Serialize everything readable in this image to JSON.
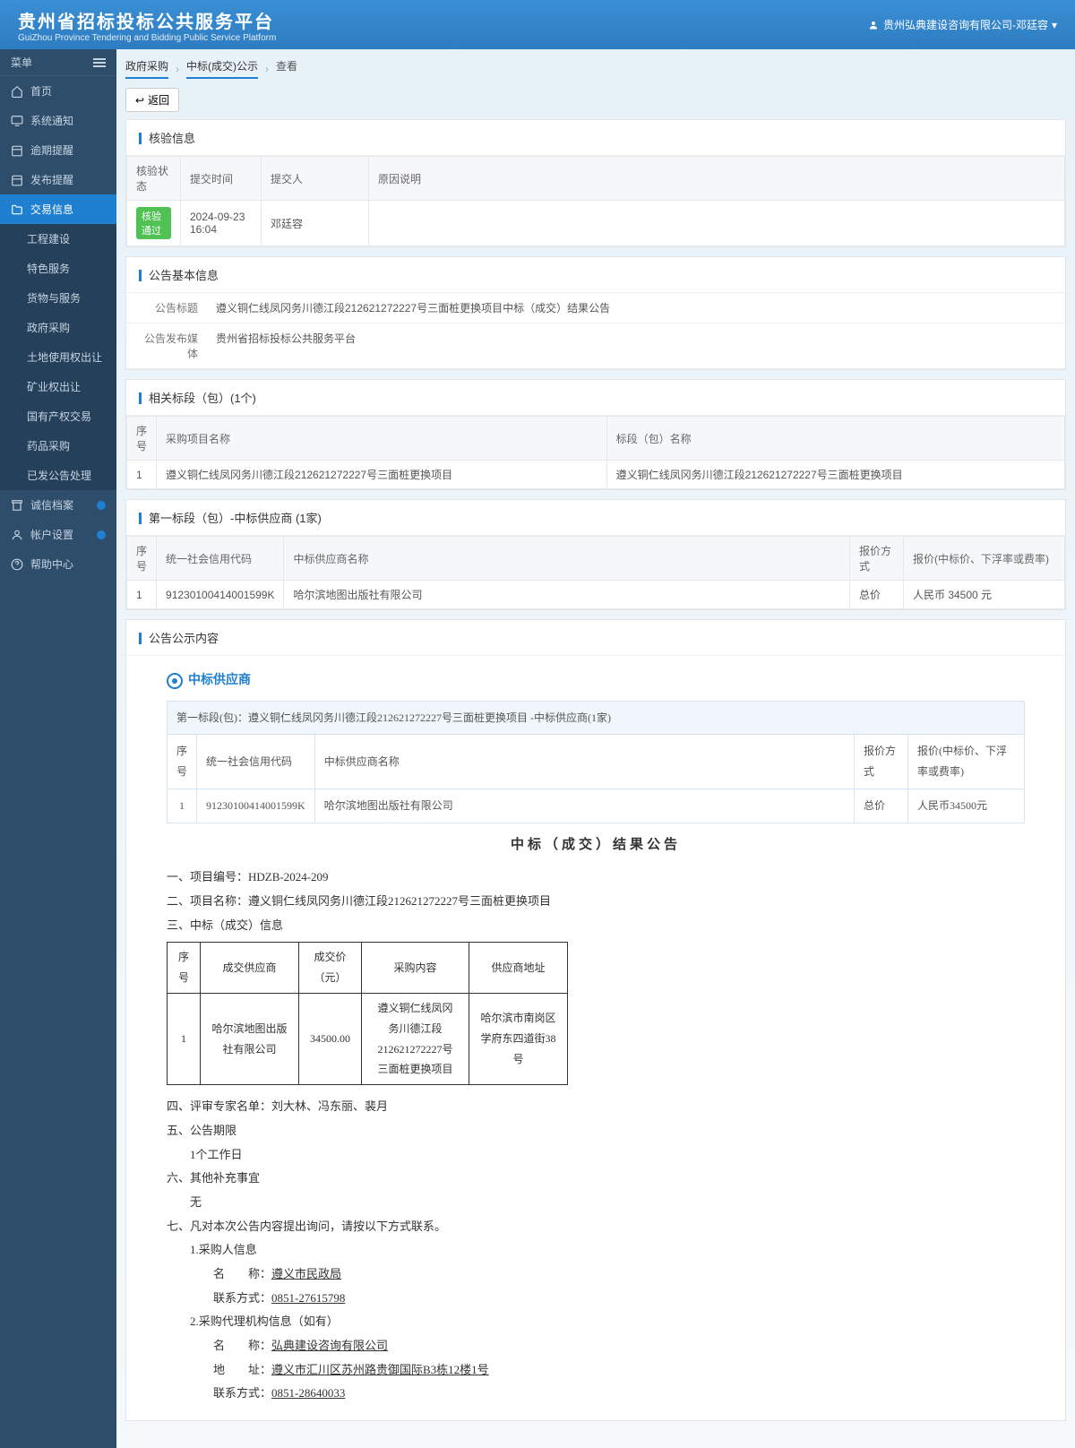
{
  "header": {
    "title": "贵州省招标投标公共服务平台",
    "subtitle": "GuiZhou Province Tendering and Bidding Public Service Platform",
    "user": "贵州弘典建设咨询有限公司-邓廷容"
  },
  "sidebar": {
    "menuLabel": "菜单",
    "items": [
      {
        "label": "首页",
        "icon": "home"
      },
      {
        "label": "系统通知",
        "icon": "monitor"
      },
      {
        "label": "逾期提醒",
        "icon": "calendar"
      },
      {
        "label": "发布提醒",
        "icon": "calendar"
      },
      {
        "label": "交易信息",
        "icon": "folder",
        "active": true,
        "badge": true,
        "sub": [
          {
            "label": "工程建设"
          },
          {
            "label": "特色服务"
          },
          {
            "label": "货物与服务"
          },
          {
            "label": "政府采购"
          },
          {
            "label": "土地使用权出让"
          },
          {
            "label": "矿业权出让"
          },
          {
            "label": "国有产权交易"
          },
          {
            "label": "药品采购"
          },
          {
            "label": "已发公告处理"
          }
        ]
      },
      {
        "label": "诚信档案",
        "icon": "archive",
        "badge": true
      },
      {
        "label": "帐户设置",
        "icon": "user",
        "badge": true
      },
      {
        "label": "帮助中心",
        "icon": "help"
      }
    ]
  },
  "breadcrumb": [
    "政府采购",
    "中标(成交)公示",
    "查看"
  ],
  "backBtn": "返回",
  "checkInfo": {
    "title": "核验信息",
    "headers": [
      "核验状态",
      "提交时间",
      "提交人",
      "原因说明"
    ],
    "row": {
      "status": "核验通过",
      "time": "2024-09-23 16:04",
      "person": "邓廷容",
      "reason": ""
    }
  },
  "basicInfo": {
    "title": "公告基本信息",
    "rows": [
      {
        "label": "公告标题",
        "value": "遵义铜仁线凤冈务川德江段212621272227号三面桩更换项目中标（成交）结果公告"
      },
      {
        "label": "公告发布媒体",
        "value": "贵州省招标投标公共服务平台"
      }
    ]
  },
  "relatedLot": {
    "title": "相关标段（包）(1个)",
    "headers": [
      "序号",
      "采购项目名称",
      "标段（包）名称"
    ],
    "rows": [
      [
        "1",
        "遵义铜仁线凤冈务川德江段212621272227号三面桩更换项目",
        "遵义铜仁线凤冈务川德江段212621272227号三面桩更换项目"
      ]
    ]
  },
  "supplier": {
    "title": "第一标段（包）-中标供应商 (1家)",
    "headers": [
      "序号",
      "统一社会信用代码",
      "中标供应商名称",
      "报价方式",
      "报价(中标价、下浮率或费率)"
    ],
    "rows": [
      [
        "1",
        "91230100414001599K",
        "哈尔滨地图出版社有限公司",
        "总价",
        "人民币 34500 元"
      ]
    ]
  },
  "announceContent": {
    "title": "公告公示内容",
    "supplierHeader": "中标供应商",
    "innerTitle": "第一标段(包)：遵义铜仁线凤冈务川德江段212621272227号三面桩更换项目 -中标供应商(1家)",
    "innerHeaders": [
      "序号",
      "统一社会信用代码",
      "中标供应商名称",
      "报价方式",
      "报价(中标价、下浮率或费率)"
    ],
    "innerRow": [
      "1",
      "91230100414001599K",
      "哈尔滨地图出版社有限公司",
      "总价",
      "人民币34500元"
    ],
    "resultTitle": "中标（成交）结果公告",
    "lines": {
      "l1": "一、项目编号：HDZB-2024-209",
      "l2": "二、项目名称：遵义铜仁线凤冈务川德江段212621272227号三面桩更换项目",
      "l3": "三、中标（成交）信息",
      "dealHeaders": [
        "序号",
        "成交供应商",
        "成交价（元）",
        "采购内容",
        "供应商地址"
      ],
      "dealRow": [
        "1",
        "哈尔滨地图出版社有限公司",
        "34500.00",
        "遵义铜仁线凤冈务川德江段212621272227号三面桩更换项目",
        "哈尔滨市南岗区学府东四道街38号"
      ],
      "l4": "四、评审专家名单：刘大林、冯东丽、裴月",
      "l5": "五、公告期限",
      "l5b": "1个工作日",
      "l6": "六、其他补充事宜",
      "l6b": "无",
      "l7": "七、凡对本次公告内容提出询问，请按以下方式联系。",
      "l7a": "1.采购人信息",
      "l7a_name_label": "名　　称：",
      "l7a_name": "遵义市民政局",
      "l7a_contact_label": "联系方式：",
      "l7a_contact": "0851-27615798",
      "l7b": "2.采购代理机构信息（如有）",
      "l7b_name_label": "名　　称：",
      "l7b_name": "弘典建设咨询有限公司",
      "l7b_addr_label": "地　　址：",
      "l7b_addr": "遵义市汇川区苏州路贵御国际B3栋12楼1号",
      "l7b_contact_label": "联系方式：",
      "l7b_contact": "0851-28640033"
    }
  }
}
